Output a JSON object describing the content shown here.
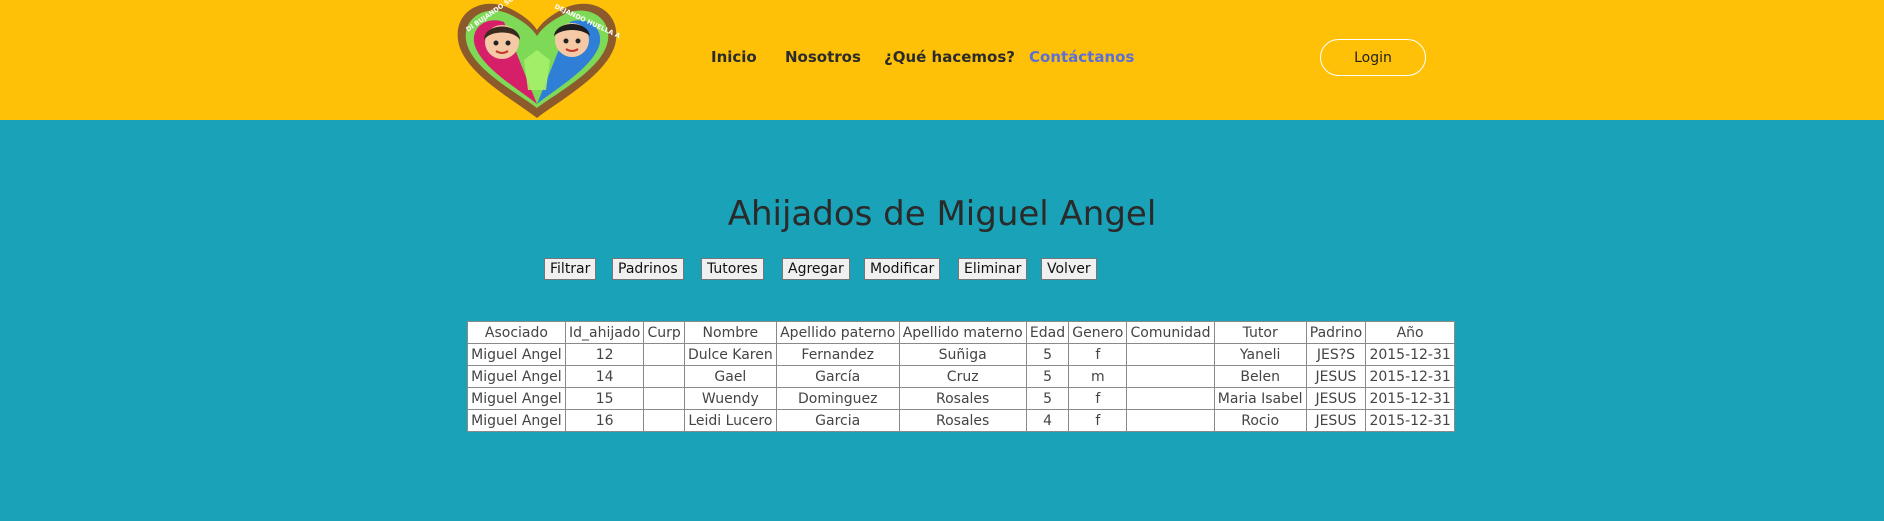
{
  "header": {
    "logo_text_left": "DI BUJANDO SONRISAS",
    "logo_text_right": "DEJANDO HUELLA A.C.",
    "nav": [
      "Inicio",
      "Nosotros",
      "¿Qué hacemos?",
      "Contáctanos"
    ],
    "active_nav": "Contáctanos",
    "login_label": "Login"
  },
  "main": {
    "title": "Ahijados de Miguel Angel",
    "buttons": [
      "Filtrar",
      "Padrinos",
      "Tutores",
      "Agregar",
      "Modificar",
      "Eliminar",
      "Volver"
    ]
  },
  "table": {
    "headers": [
      "Asociado",
      "Id_ahijado",
      "Curp",
      "Nombre",
      "Apellido paterno",
      "Apellido materno",
      "Edad",
      "Genero",
      "Comunidad",
      "Tutor",
      "Padrino",
      "Año"
    ],
    "rows": [
      [
        "Miguel Angel",
        "12",
        "",
        "Dulce Karen",
        "Fernandez",
        "Suñiga",
        "5",
        "f",
        "",
        "Yaneli",
        "JES?S",
        "2015-12-31"
      ],
      [
        "Miguel Angel",
        "14",
        "",
        "Gael",
        "García",
        "Cruz",
        "5",
        "m",
        "",
        "Belen",
        "JESUS",
        "2015-12-31"
      ],
      [
        "Miguel Angel",
        "15",
        "",
        "Wuendy",
        "Dominguez",
        "Rosales",
        "5",
        "f",
        "",
        "Maria Isabel",
        "JESUS",
        "2015-12-31"
      ],
      [
        "Miguel Angel",
        "16",
        "",
        "Leidi Lucero",
        "Garcia",
        "Rosales",
        "4",
        "f",
        "",
        "Rocio",
        "JESUS",
        "2015-12-31"
      ]
    ]
  },
  "colors": {
    "header_bg": "#ffc107",
    "page_bg": "#1aa3b8",
    "active_link": "#5b6fd6"
  }
}
